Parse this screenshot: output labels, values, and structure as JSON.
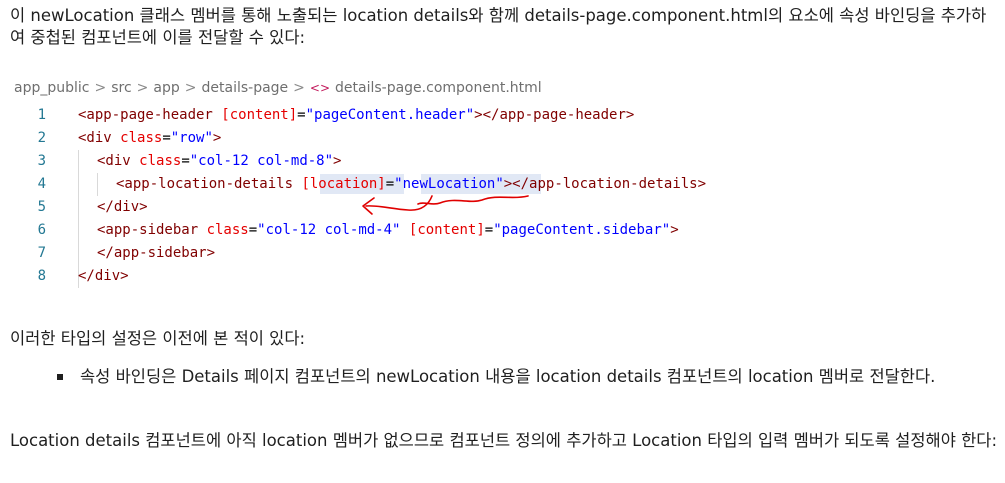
{
  "paragraphs": {
    "intro": "이 newLocation 클래스 멤버를 통해 노출되는 location details와 함께 details-page.component.html의 요소에 속성 바인딩을 추가하여 중첩된 컴포넌트에 이를 전달할 수 있다:",
    "seen_before": "이러한 타입의 설정은 이전에 본 적이 있다:",
    "bullet": "속성 바인딩은 Details 페이지 컴포넌트의 newLocation 내용을 location details 컴포넌트의 location 멤버로 전달한다.",
    "closing": "Location details 컴포넌트에 아직 location 멤버가 없으므로 컴포넌트 정의에 추가하고 Location 타입의 입력 멤버가 되도록 설정해야 한다:"
  },
  "breadcrumb": {
    "items": [
      "app_public",
      "src",
      "app",
      "details-page",
      "details-page.component.html"
    ],
    "separator": ">",
    "file_icon": "<>"
  },
  "code": {
    "line_numbers": [
      "1",
      "2",
      "3",
      "4",
      "5",
      "6",
      "7",
      "8"
    ],
    "lines": [
      [
        {
          "t": "tag",
          "v": "<app-page-header "
        },
        {
          "t": "attr",
          "v": "[content]"
        },
        {
          "t": "plain",
          "v": "="
        },
        {
          "t": "str",
          "v": "\"pageContent.header\""
        },
        {
          "t": "tag",
          "v": "></app-page-header>"
        }
      ],
      [
        {
          "t": "tag",
          "v": "<div "
        },
        {
          "t": "attr",
          "v": "class"
        },
        {
          "t": "plain",
          "v": "="
        },
        {
          "t": "str",
          "v": "\"row\""
        },
        {
          "t": "tag",
          "v": ">"
        }
      ],
      [
        {
          "t": "tag",
          "v": "<div "
        },
        {
          "t": "attr",
          "v": "class"
        },
        {
          "t": "plain",
          "v": "="
        },
        {
          "t": "str",
          "v": "\"col-12 col-md-8\""
        },
        {
          "t": "tag",
          "v": ">"
        }
      ],
      [
        {
          "t": "tag",
          "v": "<app-location-details "
        },
        {
          "t": "attr",
          "v": "[location]"
        },
        {
          "t": "plain",
          "v": "="
        },
        {
          "t": "str",
          "v": "\"newLocation\""
        },
        {
          "t": "tag",
          "v": "></app-location-details>"
        }
      ],
      [
        {
          "t": "tag",
          "v": "</div>"
        }
      ],
      [
        {
          "t": "tag",
          "v": "<app-sidebar "
        },
        {
          "t": "attr",
          "v": "class"
        },
        {
          "t": "plain",
          "v": "="
        },
        {
          "t": "str",
          "v": "\"col-12 col-md-4\" "
        },
        {
          "t": "attr",
          "v": "[content]"
        },
        {
          "t": "plain",
          "v": "="
        },
        {
          "t": "str",
          "v": "\"pageContent.sidebar\""
        },
        {
          "t": "tag",
          "v": ">"
        }
      ],
      [
        {
          "t": "tag",
          "v": "</app-sidebar>"
        }
      ],
      [
        {
          "t": "tag",
          "v": "</div>"
        }
      ]
    ]
  },
  "colors": {
    "tag": "#800000",
    "attribute": "#e50000",
    "string": "#0000ff",
    "line_number": "#237893",
    "annotation": "#e00000",
    "highlight": "#e1e8f5"
  }
}
